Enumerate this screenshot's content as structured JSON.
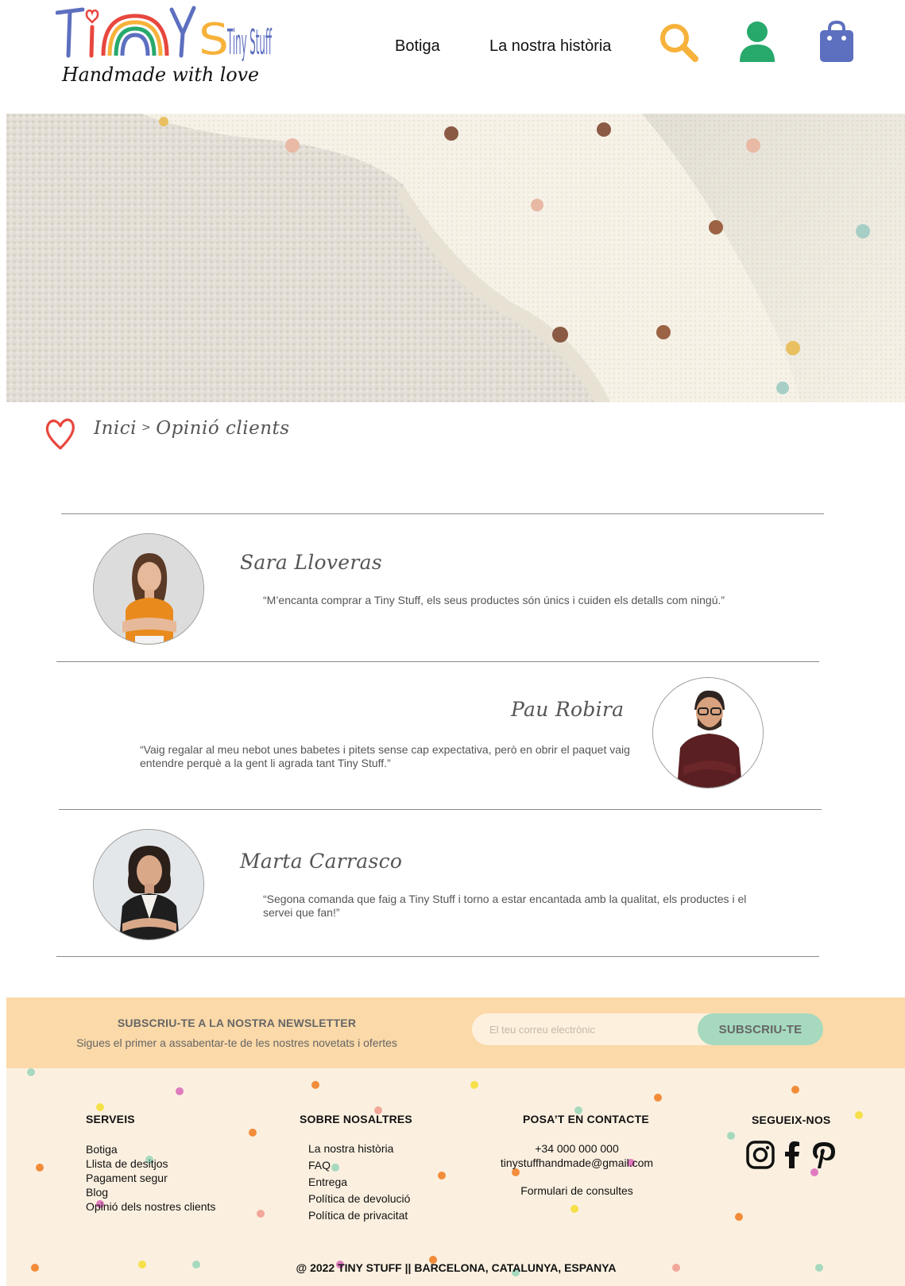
{
  "header": {
    "logo_title": "Tiny Stuff",
    "logo_tagline": "Handmade with love",
    "nav": [
      {
        "label": "Botiga"
      },
      {
        "label": "La nostra història"
      }
    ],
    "icons": [
      "search-icon",
      "user-icon",
      "shopping-bag-icon"
    ],
    "colors": {
      "search": "#f7b23b",
      "user": "#27a96c",
      "bag": "#5d6fbf"
    }
  },
  "breadcrumb": {
    "home": "Inici",
    "separator": ">",
    "current": "Opinió clients"
  },
  "testimonials": [
    {
      "name": "Sara Lloveras",
      "quote": "“M’encanta comprar a Tiny Stuff, els seus productes són únics i cuiden els detalls com ningú.”"
    },
    {
      "name": "Pau Robira",
      "quote": "“Vaig regalar al meu nebot unes babetes i pitets sense cap expectativa, però en obrir el paquet vaig entendre perquè a la gent li agrada tant Tiny Stuff.”"
    },
    {
      "name": "Marta Carrasco",
      "quote": "“Segona comanda que faig a Tiny Stuff i torno a estar encantada amb la qualitat, els productes i el servei que fan!”"
    }
  ],
  "newsletter": {
    "title": "SUBSCRIU-TE A LA NOSTRA NEWSLETTER",
    "subtitle": "Sigues el primer a assabentar-te de les nostres novetats i ofertes",
    "email_placeholder": "El teu correu electrònic",
    "button_label": "SUBSCRIU-TE",
    "colors": {
      "band": "#fbd9a8",
      "button": "#a6d9be"
    }
  },
  "footer": {
    "serveis": {
      "heading": "SERVEIS",
      "links": [
        "Botiga",
        "Llista de desitjos",
        "Pagament segur",
        "Blog",
        "Opinió dels nostres clients"
      ]
    },
    "sobre": {
      "heading": "SOBRE NOSALTRES",
      "links": [
        "La nostra història",
        "FAQ",
        "Entrega",
        "Política de devolució",
        "Política de privacitat"
      ]
    },
    "contacte": {
      "heading": "POSA’T EN CONTACTE",
      "phone": "+34 000 000 000",
      "email": "tinystuffhandmade@gmail.com",
      "form_link": "Formulari de consultes"
    },
    "social": {
      "heading": "SEGUEIX-NOS",
      "icons": [
        "instagram-icon",
        "facebook-icon",
        "pinterest-icon"
      ]
    },
    "copyright": "@ 2022 TINY STUFF || BARCELONA, CATALUNYA, ESPANYA",
    "background": "#fbf0e0"
  }
}
